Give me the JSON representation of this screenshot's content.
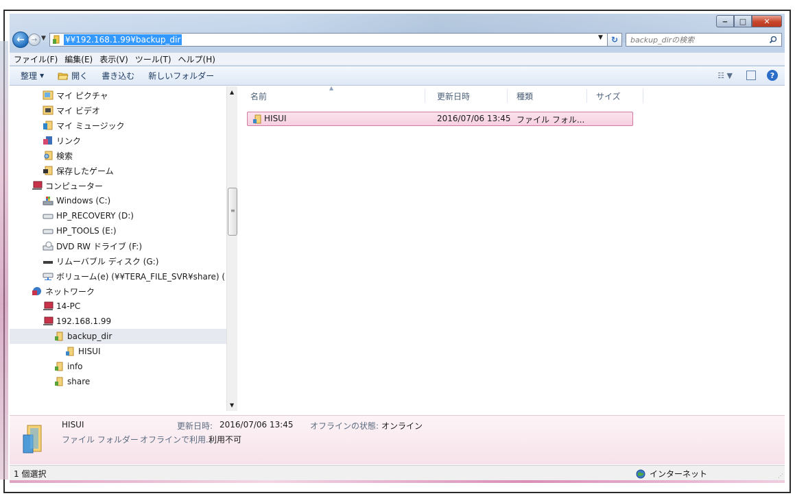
{
  "address": {
    "path": "¥¥192.168.1.99¥backup_dir"
  },
  "search": {
    "placeholder": "backup_dirの検索"
  },
  "menu": [
    "ファイル(F)",
    "編集(E)",
    "表示(V)",
    "ツール(T)",
    "ヘルプ(H)"
  ],
  "toolbar": {
    "organize": "整理",
    "open": "開く",
    "burn": "書き込む",
    "new_folder": "新しいフォルダー"
  },
  "tree": [
    {
      "label": "マイ ピクチャ",
      "icon": "pictures-icon"
    },
    {
      "label": "マイ ビデオ",
      "icon": "videos-icon"
    },
    {
      "label": "マイ ミュージック",
      "icon": "music-icon"
    },
    {
      "label": "リンク",
      "icon": "links-icon"
    },
    {
      "label": "検索",
      "icon": "search-folder-icon"
    },
    {
      "label": "保存したゲーム",
      "icon": "games-icon"
    },
    {
      "label": "コンピューター",
      "icon": "computer-icon"
    },
    {
      "label": "Windows (C:)",
      "icon": "windows-drive-icon"
    },
    {
      "label": "HP_RECOVERY (D:)",
      "icon": "drive-icon"
    },
    {
      "label": "HP_TOOLS (E:)",
      "icon": "drive-icon"
    },
    {
      "label": "DVD RW ドライブ (F:)",
      "icon": "dvd-icon"
    },
    {
      "label": "リムーバブル ディスク (G:)",
      "icon": "removable-icon"
    },
    {
      "label": "ボリューム(e) (¥¥TERA_FILE_SVR¥share) (",
      "icon": "network-drive-icon"
    },
    {
      "label": "ネットワーク",
      "icon": "network-icon"
    },
    {
      "label": "14-PC",
      "icon": "computer-icon"
    },
    {
      "label": "192.168.1.99",
      "icon": "computer-icon"
    },
    {
      "label": "backup_dir",
      "icon": "shared-folder-icon"
    },
    {
      "label": "HISUI",
      "icon": "folder-icon"
    },
    {
      "label": "info",
      "icon": "shared-folder-icon"
    },
    {
      "label": "share",
      "icon": "shared-folder-icon"
    }
  ],
  "columns": {
    "name": "名前",
    "modified": "更新日時",
    "type": "種類",
    "size": "サイズ"
  },
  "files": [
    {
      "name": "HISUI",
      "modified": "2016/07/06 13:45",
      "type": "ファイル フォル...",
      "size": ""
    }
  ],
  "details": {
    "name": "HISUI",
    "modified_label": "更新日時:",
    "modified_value": "2016/07/06 13:45",
    "offline_status_label": "オフラインの状態:",
    "offline_status_value": "オンライン",
    "type_value": "ファイル フォルダー",
    "offline_avail_label": "オフラインで利用...",
    "offline_avail_value": "利用不可"
  },
  "status": {
    "selection": "1 個選択",
    "zone": "インターネット"
  }
}
